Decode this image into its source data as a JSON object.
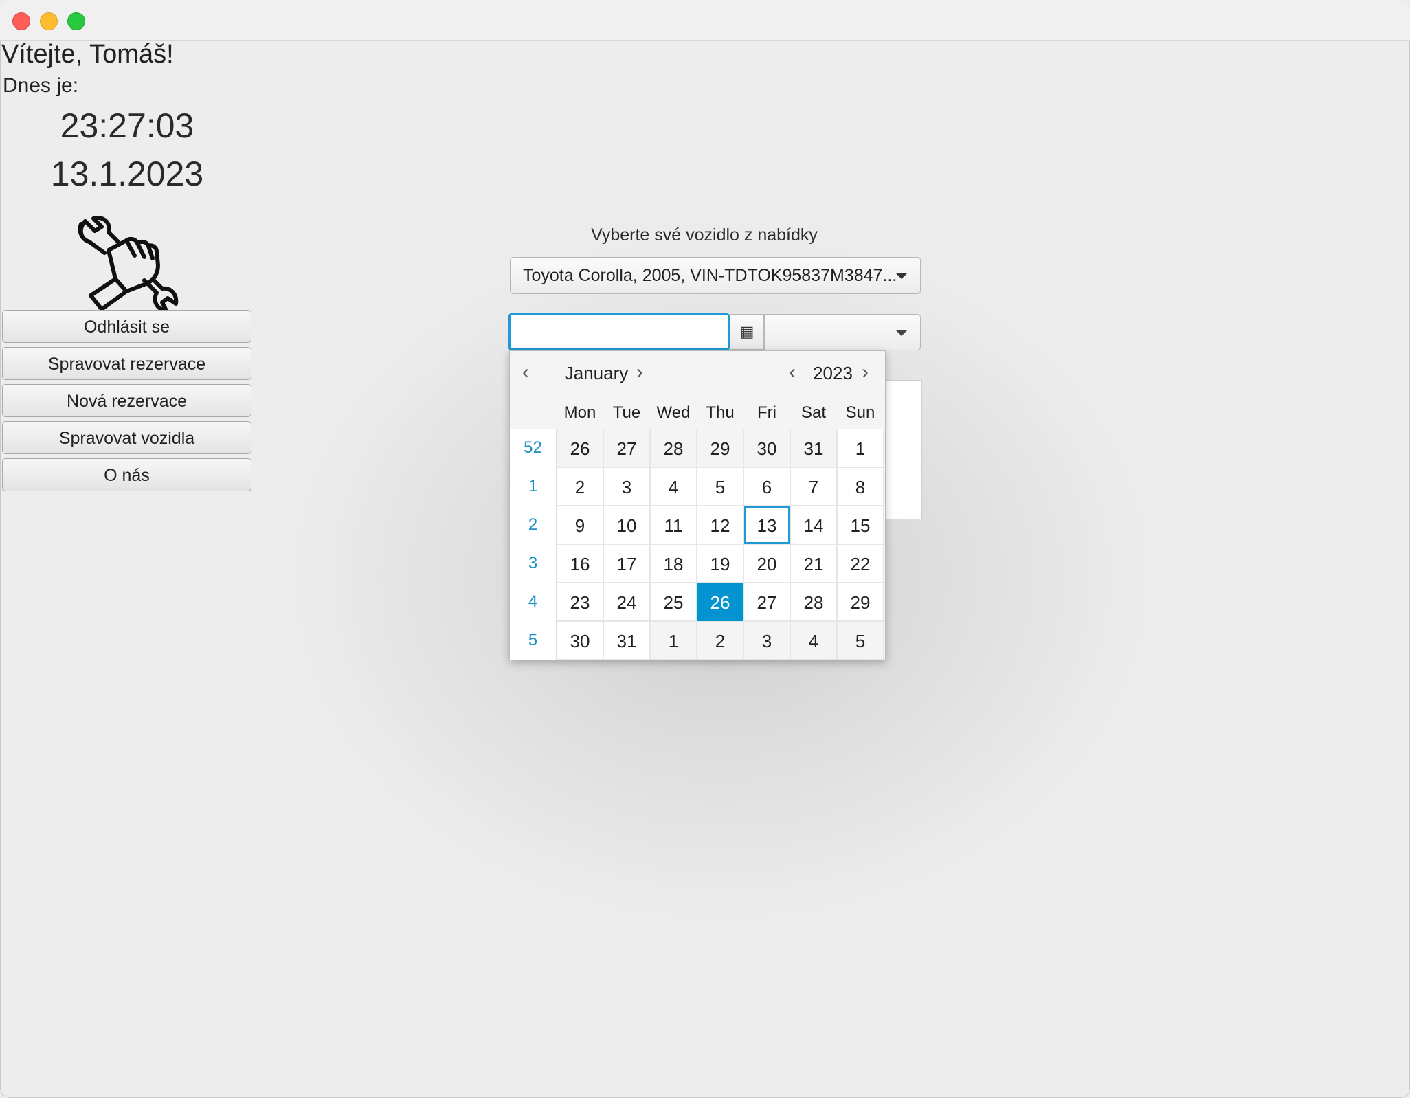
{
  "window": {
    "controls": [
      "close",
      "minimize",
      "maximize"
    ]
  },
  "greeting": "Vítejte, Tomáš!",
  "today_label": "Dnes je:",
  "clock": {
    "time": "23:27:03",
    "date": "13.1.2023"
  },
  "logo": {
    "icon": "wrench-in-fist-icon"
  },
  "sidebar": {
    "buttons": [
      {
        "label": "Odhlásit se"
      },
      {
        "label": "Spravovat rezervace"
      },
      {
        "label": "Nová rezervace"
      },
      {
        "label": "Spravovat vozidla"
      },
      {
        "label": "O nás"
      }
    ]
  },
  "reservation": {
    "prompt": "Vyberte své vozidlo z nabídky",
    "vehicle_selected": "Toyota Corolla, 2005, VIN-TDTOK95837M3847...",
    "date_value": "",
    "time_value": "",
    "calendar_icon": "calendar-icon"
  },
  "calendar": {
    "month": "January",
    "year": "2023",
    "weekdays": [
      "Mon",
      "Tue",
      "Wed",
      "Thu",
      "Fri",
      "Sat",
      "Sun"
    ],
    "weeks": [
      {
        "week": "52",
        "days": [
          "26",
          "27",
          "28",
          "29",
          "30",
          "31",
          "1"
        ],
        "other_month": [
          true,
          true,
          true,
          true,
          true,
          true,
          false
        ]
      },
      {
        "week": "1",
        "days": [
          "2",
          "3",
          "4",
          "5",
          "6",
          "7",
          "8"
        ],
        "other_month": [
          false,
          false,
          false,
          false,
          false,
          false,
          false
        ]
      },
      {
        "week": "2",
        "days": [
          "9",
          "10",
          "11",
          "12",
          "13",
          "14",
          "15"
        ],
        "other_month": [
          false,
          false,
          false,
          false,
          false,
          false,
          false
        ]
      },
      {
        "week": "3",
        "days": [
          "16",
          "17",
          "18",
          "19",
          "20",
          "21",
          "22"
        ],
        "other_month": [
          false,
          false,
          false,
          false,
          false,
          false,
          false
        ]
      },
      {
        "week": "4",
        "days": [
          "23",
          "24",
          "25",
          "26",
          "27",
          "28",
          "29"
        ],
        "other_month": [
          false,
          false,
          false,
          false,
          false,
          false,
          false
        ]
      },
      {
        "week": "5",
        "days": [
          "30",
          "31",
          "1",
          "2",
          "3",
          "4",
          "5"
        ],
        "other_month": [
          false,
          false,
          true,
          true,
          true,
          true,
          true
        ]
      }
    ],
    "today": "13",
    "selected": "26",
    "colors": {
      "accent": "#0393d0",
      "week_number": "#1b8fc4"
    }
  }
}
